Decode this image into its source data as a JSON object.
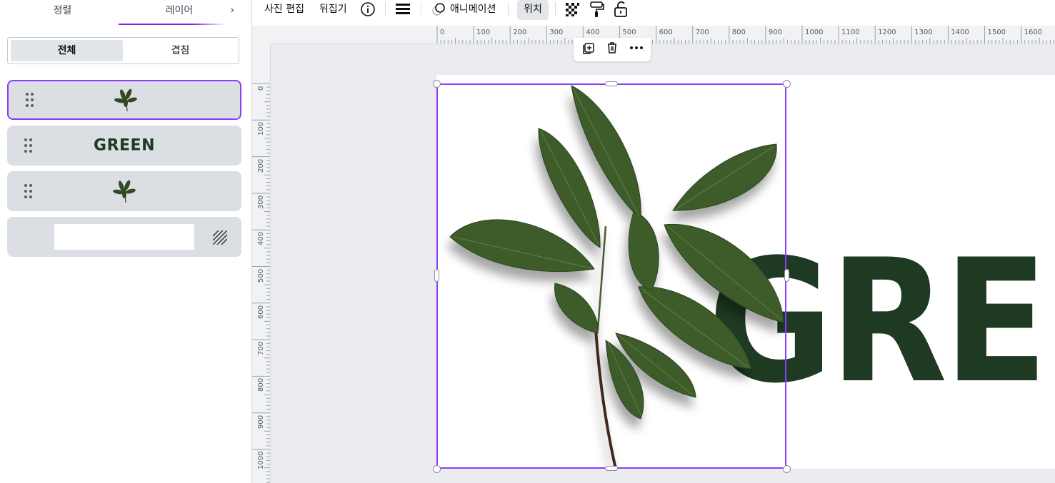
{
  "left_panel": {
    "tabs": {
      "arrange": "정렬",
      "layers": "레이어",
      "next_glyph": "›"
    },
    "filter": {
      "all": "전체",
      "overlap": "겹침"
    },
    "layers": [
      {
        "kind": "image",
        "selected": true
      },
      {
        "kind": "text",
        "label": "GREEN"
      },
      {
        "kind": "image",
        "selected": false
      },
      {
        "kind": "background"
      }
    ]
  },
  "toolbar": {
    "photo_edit": "사진 편집",
    "flip": "뒤집기",
    "animation": "애니메이션",
    "position": "위치",
    "icons": [
      "info-icon",
      "border-style-icon",
      "transparency-icon",
      "copy-style-icon",
      "lock-icon"
    ]
  },
  "canvas": {
    "ruler_h": [
      "0",
      "100",
      "200",
      "300",
      "400",
      "500",
      "600",
      "700",
      "800",
      "900",
      "1000",
      "1100",
      "1200",
      "1300",
      "1400",
      "1500",
      "1600"
    ],
    "ruler_v": [
      "0",
      "100",
      "200",
      "300",
      "400",
      "500",
      "600",
      "700",
      "800",
      "900",
      "1000"
    ],
    "heading_text": "GREEN",
    "float_toolbar": [
      "duplicate-icon",
      "delete-icon",
      "more-icon"
    ],
    "colors": {
      "accent": "#8b3dff",
      "text_green": "#1e3a22",
      "leaf": "#3d5a2b"
    }
  }
}
